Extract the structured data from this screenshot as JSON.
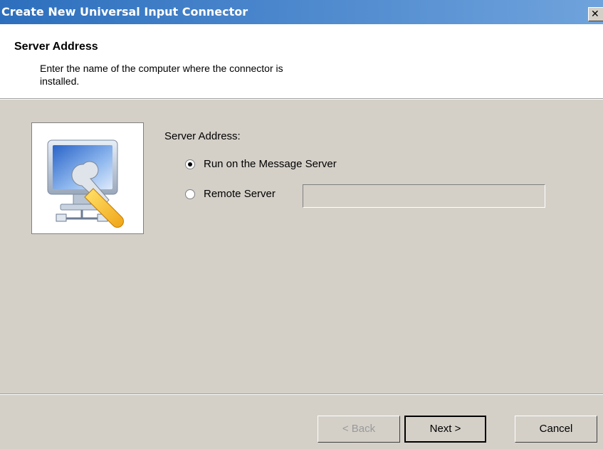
{
  "window": {
    "title": "Create New Universal Input Connector",
    "close_glyph": "✕"
  },
  "header": {
    "title": "Server Address",
    "subtitle": "Enter the name of the computer where the connector is installed."
  },
  "form": {
    "group_label": "Server Address:",
    "options": [
      {
        "label": "Run on the Message Server",
        "selected": true
      },
      {
        "label": "Remote Server",
        "selected": false
      }
    ],
    "remote_server_value": ""
  },
  "buttons": {
    "back": "< Back",
    "next": "Next >",
    "cancel": "Cancel"
  },
  "icons": {
    "wizard_image": "computer-with-wrench-icon",
    "close": "close-icon"
  },
  "colors": {
    "title_bar": "#2d6fbd",
    "dialog_bg": "#d4d0c8",
    "header_bg": "#ffffff"
  }
}
